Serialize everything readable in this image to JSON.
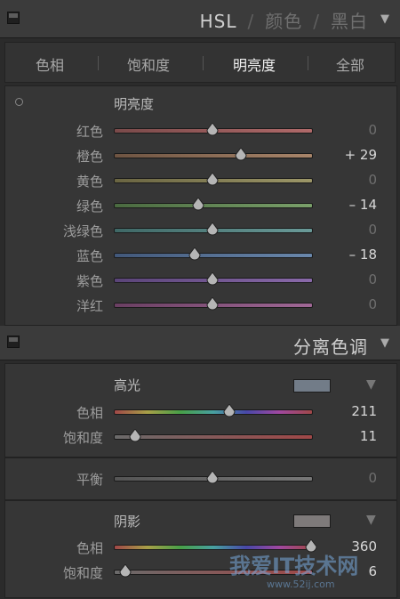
{
  "hsl_header": {
    "title_active": "HSL",
    "title_2": "颜色",
    "title_3": "黑白",
    "separator": "/"
  },
  "tabs": [
    "色相",
    "饱和度",
    "明亮度",
    "全部"
  ],
  "active_tab": 2,
  "luminance": {
    "heading": "明亮度",
    "rows": [
      {
        "label": "红色",
        "value": "0",
        "fraction": 0.5,
        "colors": [
          "#7a4a4a",
          "#b06a6a"
        ]
      },
      {
        "label": "橙色",
        "value": "+ 29",
        "fraction": 0.645,
        "colors": [
          "#6e5442",
          "#a8856a"
        ]
      },
      {
        "label": "黄色",
        "value": "0",
        "fraction": 0.5,
        "colors": [
          "#6a6542",
          "#9c9668"
        ]
      },
      {
        "label": "绿色",
        "value": "– 14",
        "fraction": 0.43,
        "colors": [
          "#4a6a40",
          "#7aa06a"
        ]
      },
      {
        "label": "浅绿色",
        "value": "0",
        "fraction": 0.5,
        "colors": [
          "#3f6866",
          "#6a9a98"
        ]
      },
      {
        "label": "蓝色",
        "value": "– 18",
        "fraction": 0.41,
        "colors": [
          "#42587a",
          "#6a88ac"
        ]
      },
      {
        "label": "紫色",
        "value": "0",
        "fraction": 0.5,
        "colors": [
          "#5a4478",
          "#8a6aaa"
        ]
      },
      {
        "label": "洋红",
        "value": "0",
        "fraction": 0.5,
        "colors": [
          "#6a3f62",
          "#a06896"
        ]
      }
    ]
  },
  "split_toning": {
    "title": "分离色调",
    "highlights": {
      "label": "高光",
      "swatch": "#727c88",
      "hue": {
        "label": "色相",
        "value": "211",
        "fraction": 0.586
      },
      "saturation": {
        "label": "饱和度",
        "value": "11",
        "fraction": 0.11
      }
    },
    "balance": {
      "label": "平衡",
      "value": "0",
      "fraction": 0.5
    },
    "shadows": {
      "label": "阴影",
      "swatch": "#7e7a7a",
      "hue": {
        "label": "色相",
        "value": "360",
        "fraction": 1.0
      },
      "saturation": {
        "label": "饱和度",
        "value": "6",
        "fraction": 0.06
      }
    }
  },
  "watermark": {
    "text": "我爱IT技术网",
    "sub": "www.52ij.com"
  }
}
